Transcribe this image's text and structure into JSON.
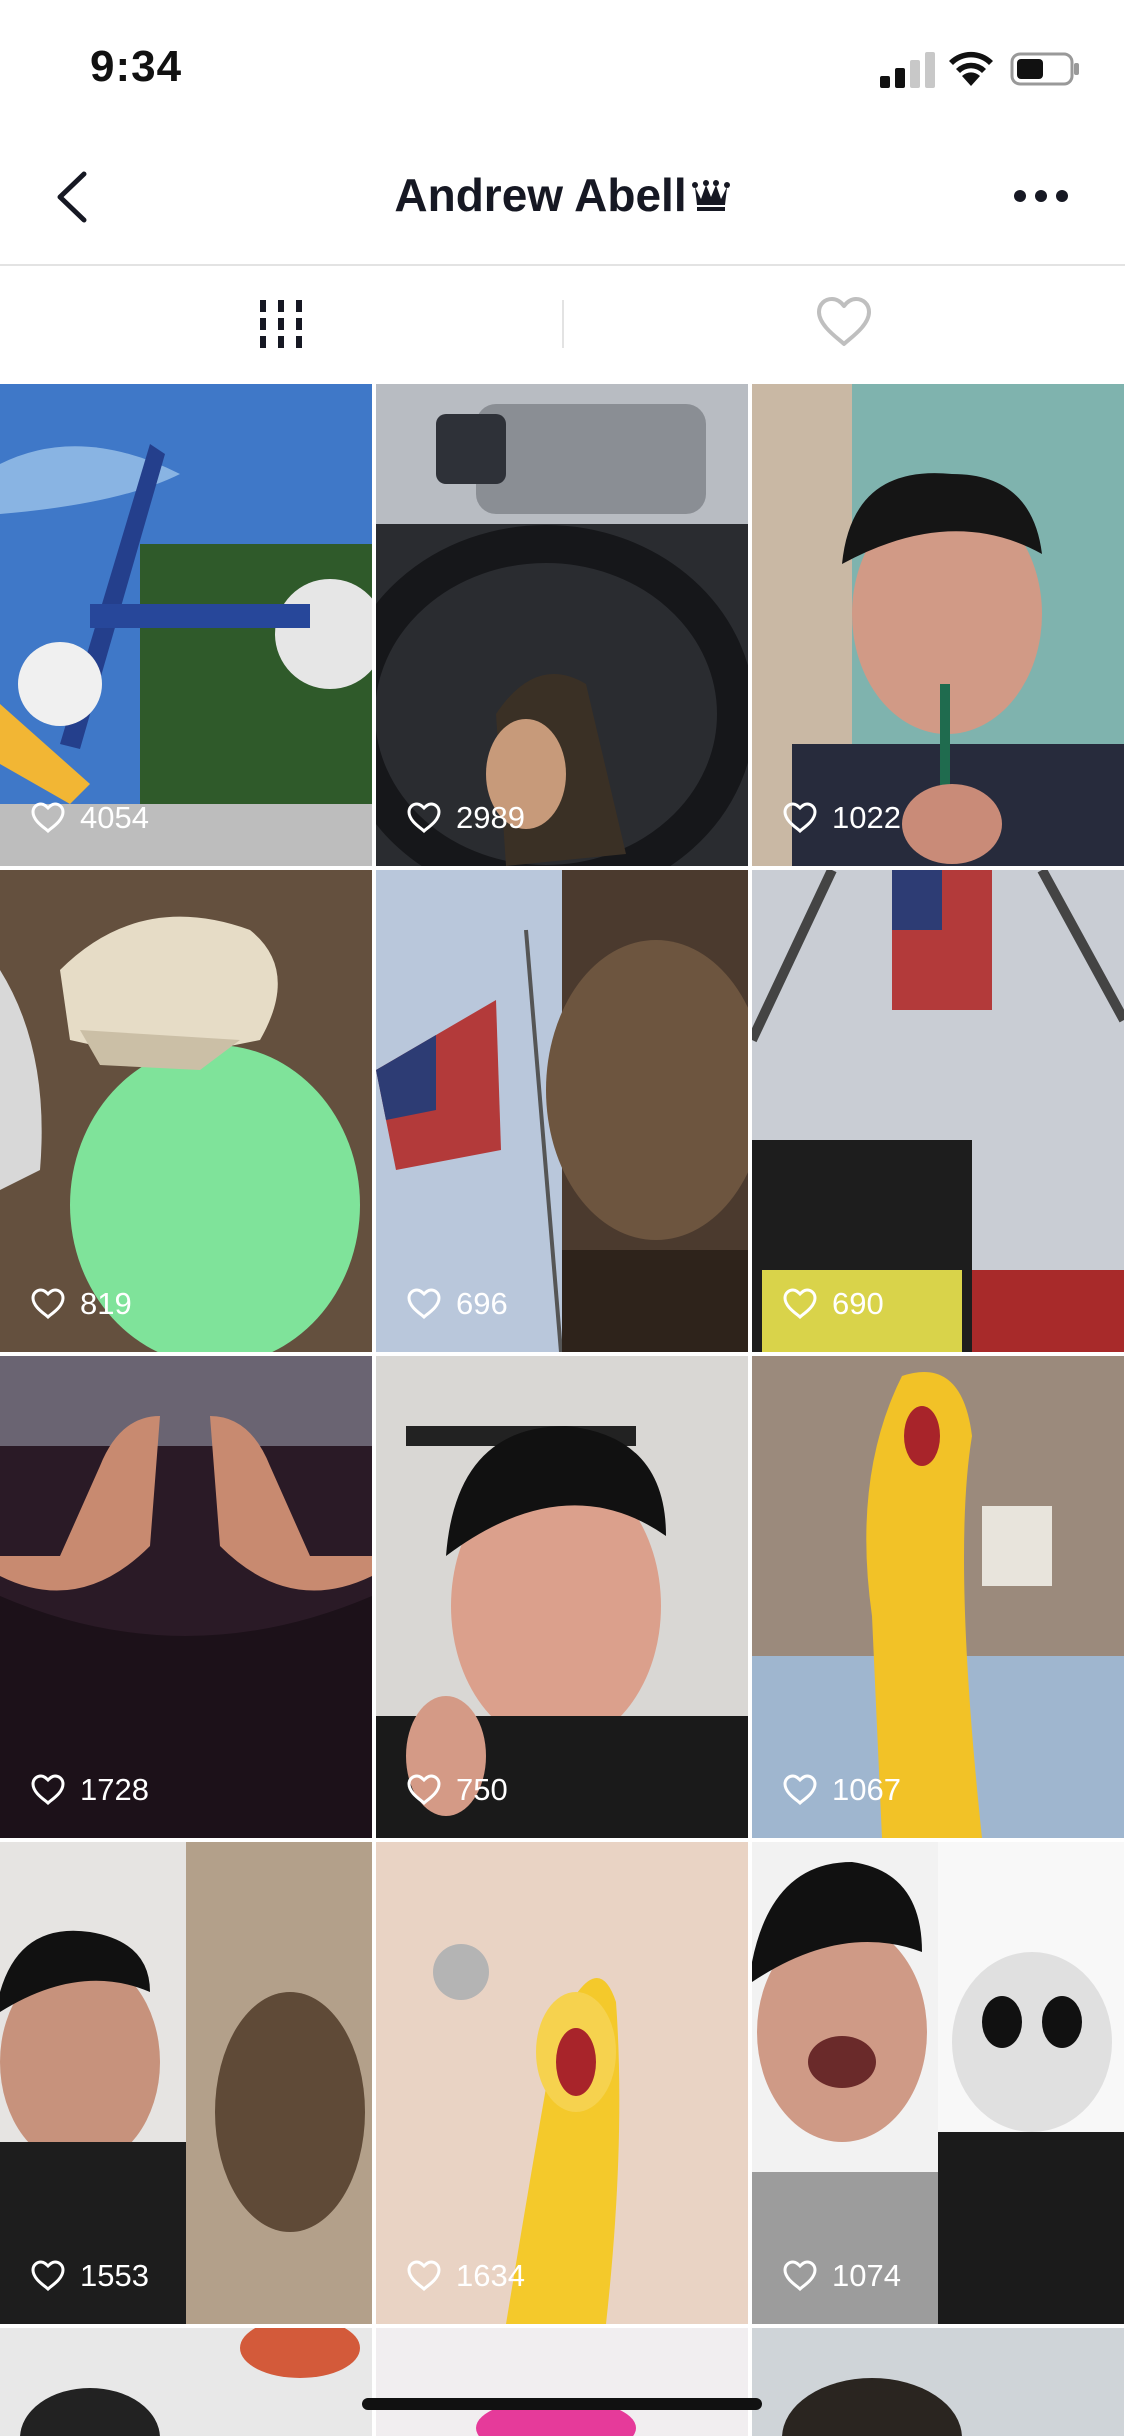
{
  "status": {
    "time": "9:34"
  },
  "header": {
    "title": "Andrew Abell",
    "crown_icon": "crown-icon"
  },
  "tabs": [
    {
      "name": "posts",
      "icon": "grid-icon",
      "active": true
    },
    {
      "name": "liked",
      "icon": "heart-outline-icon",
      "active": false
    }
  ],
  "videos": [
    {
      "likes": "4054",
      "scene": "carnival-ride"
    },
    {
      "likes": "2989",
      "scene": "car-steering-wheel"
    },
    {
      "likes": "1022",
      "scene": "man-backwards-cap"
    },
    {
      "likes": "819",
      "scene": "dinosaur-egg"
    },
    {
      "likes": "696",
      "scene": "flag-and-fire-helmet"
    },
    {
      "likes": "690",
      "scene": "flag-over-fire-trucks"
    },
    {
      "likes": "1728",
      "scene": "praying-hands"
    },
    {
      "likes": "750",
      "scene": "man-backwards-cap"
    },
    {
      "likes": "1067",
      "scene": "rubber-chicken-on-bed"
    },
    {
      "likes": "1553",
      "scene": "man-and-marmot"
    },
    {
      "likes": "1634",
      "scene": "rubber-chicken-in-sink"
    },
    {
      "likes": "1074",
      "scene": "man-and-panda"
    }
  ],
  "colors": {
    "text": "#161823",
    "divider": "#e3e3e3",
    "overlay_text": "#ffffff"
  }
}
